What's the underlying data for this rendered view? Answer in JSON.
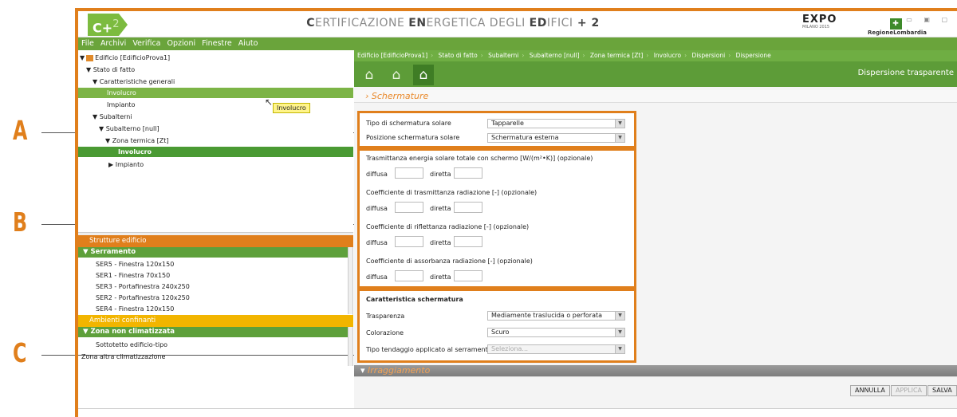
{
  "callouts": {
    "a": "A",
    "b": "B",
    "c": "C"
  },
  "app": {
    "logo_main": "C+",
    "logo_sup": "2",
    "title_p1": "C",
    "title_p2": "ERTIFICAZIONE ",
    "title_p3": "EN",
    "title_p4": "ERGETICA DEGLI ",
    "title_p5": "ED",
    "title_p6": "IFICI",
    "title_p7": " + 2",
    "expo_logo": "EXPO",
    "expo_sub": "MILANO 2015",
    "region_name": "RegioneLombardia",
    "window_buttons": "▭ ▣ ▢"
  },
  "menu": [
    "File",
    "Archivi",
    "Verifica",
    "Opzioni",
    "Finestre",
    "Aiuto"
  ],
  "tree": {
    "items": [
      "Edificio [EdificioProva1]",
      "Stato di fatto",
      "Caratteristiche generali",
      "Involucro",
      "Impianto",
      "Subalterni",
      "Subalterno [null]",
      "Zona termica [Zt]",
      "Involucro",
      "Impianto"
    ],
    "tooltip": "Involucro"
  },
  "structures": {
    "header": "Strutture edificio",
    "group": "Serramento",
    "items": [
      "SER5 - Finestra 120x150",
      "SER1 - Finestra 70x150",
      "SER3 - Portafinestra 240x250",
      "SER2 - Portafinestra 120x250",
      "SER4 - Finestra 120x150"
    ]
  },
  "ambients": {
    "header": "Ambienti confinanti",
    "group": "Zona non climatizzata",
    "items": [
      "Sottotetto edificio-tipo",
      "Zona altra climatizzazione"
    ]
  },
  "breadcrumb": [
    "Edificio [EdificioProva1]",
    "Stato di fatto",
    "Subalterni",
    "Subalterno [null]",
    "Zona termica [Zt]",
    "Involucro",
    "Dispersioni",
    "Dispersione"
  ],
  "toolbar": {
    "title": "Dispersione trasparente"
  },
  "section": {
    "title": "Schermature"
  },
  "boxA": {
    "tipo_label": "Tipo di schermatura solare",
    "tipo_value": "Tapparelle",
    "pos_label": "Posizione schermatura solare",
    "pos_value": "Schermatura esterna"
  },
  "boxB": {
    "g1": "Trasmittanza energia solare totale con schermo [W/(m²•K)] (opzionale)",
    "g2": "Coefficiente di trasmittanza radiazione [-] (opzionale)",
    "g3": "Coefficiente di riflettanza radiazione [-] (opzionale)",
    "g4": "Coefficiente di assorbanza radiazione [-] (opzionale)",
    "diffusa": "diffusa",
    "diretta": "diretta"
  },
  "boxC": {
    "title": "Caratteristica schermatura",
    "trasp_label": "Trasparenza",
    "trasp_value": "Mediamente traslucida o perforata",
    "col_label": "Colorazione",
    "col_value": "Scuro",
    "tend_label": "Tipo tendaggio applicato al serramento",
    "tend_placeholder": "Seleziona..."
  },
  "irraggiamento": {
    "title": "Irraggiamento"
  },
  "buttons": {
    "annulla": "ANNULLA",
    "applica": "APPLICA",
    "salva": "SALVA"
  },
  "colors": {
    "accent": "#e07f1c",
    "green": "#6aa43b"
  }
}
